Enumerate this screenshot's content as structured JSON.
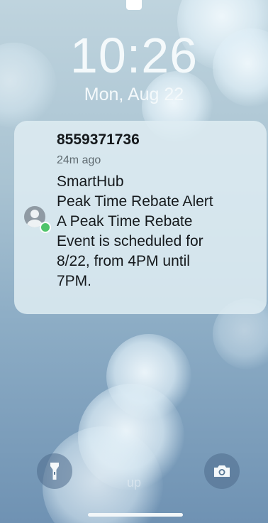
{
  "lock_screen": {
    "time": "10:26",
    "date": "Mon, Aug 22",
    "swipe_hint": "up"
  },
  "notification": {
    "sender": "8559371736",
    "time_ago": "24m ago",
    "lines": [
      "SmartHub",
      "Peak Time Rebate Alert",
      "A Peak Time Rebate",
      "Event is scheduled for",
      "8/22, from 4PM until",
      "7PM."
    ],
    "avatar_icon": "person-icon",
    "badge_color": "#4fc46a"
  },
  "controls": {
    "left_icon": "flashlight-icon",
    "right_icon": "camera-icon"
  }
}
